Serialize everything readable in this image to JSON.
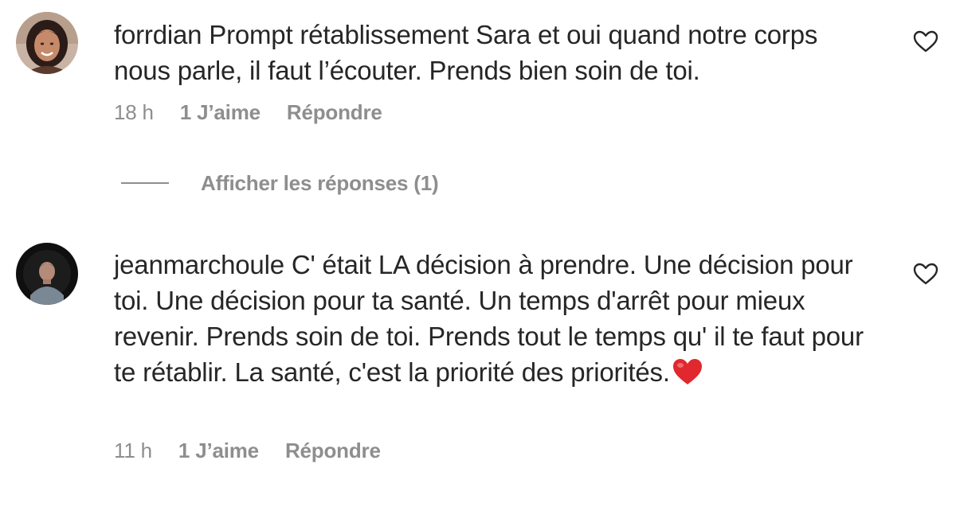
{
  "comments": [
    {
      "username": "forrdian",
      "text": "Prompt rétablissement Sara et oui quand notre corps nous parle, il faut l’écouter. Prends bien soin de toi.",
      "time": "18 h",
      "likes": "1 J’aime",
      "reply_label": "Répondre",
      "avatar_icon": "profile-photo-woman",
      "like_icon": "heart-outline-icon"
    },
    {
      "username": "jeanmarchoule",
      "text": "C' était LA décision à prendre. Une décision pour toi. Une décision pour ta santé. Un temps d'arrêt pour mieux revenir. Prends soin de toi. Prends tout le temps qu' il te faut pour te rétablir. La santé, c'est la priorité des priorités.",
      "emoji": "red-heart",
      "time": "11 h",
      "likes": "1 J’aime",
      "reply_label": "Répondre",
      "avatar_icon": "profile-photo-man",
      "like_icon": "heart-outline-icon"
    }
  ],
  "view_replies": {
    "label": "Afficher les réponses (1)"
  },
  "colors": {
    "text": "#262626",
    "secondary": "#8e8e8e",
    "heart_red": "#e0282e"
  }
}
